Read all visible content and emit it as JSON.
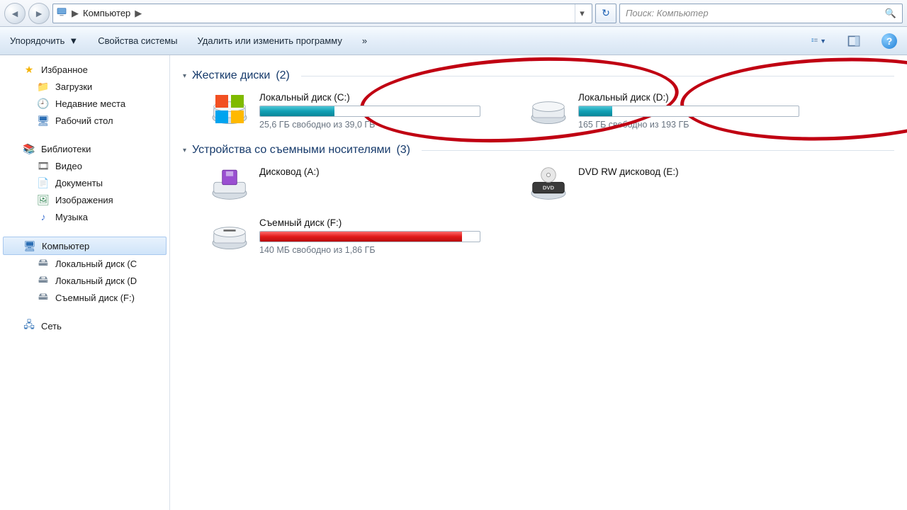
{
  "address": {
    "location": "Компьютер",
    "sep": "▶"
  },
  "search": {
    "placeholder": "Поиск: Компьютер"
  },
  "toolbar": {
    "organize": "Упорядочить",
    "sysprops": "Свойства системы",
    "uninstall": "Удалить или изменить программу",
    "more": "»"
  },
  "sidebar": {
    "favorites": "Избранное",
    "downloads": "Загрузки",
    "recent": "Недавние места",
    "desktop": "Рабочий стол",
    "libraries": "Библиотеки",
    "video": "Видео",
    "documents": "Документы",
    "pictures": "Изображения",
    "music": "Музыка",
    "computer": "Компьютер",
    "localC": "Локальный диск  (C",
    "localD": "Локальный диск (D",
    "remF": "Съемный диск (F:)",
    "network": "Сеть"
  },
  "sections": {
    "hdd": {
      "title": "Жесткие диски",
      "count": "(2)"
    },
    "removable": {
      "title": "Устройства со съемными носителями",
      "count": "(3)"
    }
  },
  "drives": {
    "c": {
      "name": "Локальный диск  (C:)",
      "sub": "25,6 ГБ свободно из 39,0 ГБ",
      "fill_pct": 34,
      "color": "teal"
    },
    "d": {
      "name": "Локальный диск (D:)",
      "sub": "165 ГБ свободно из 193 ГБ",
      "fill_pct": 15,
      "color": "teal"
    },
    "a": {
      "name": "Дисковод (A:)"
    },
    "e": {
      "name": "DVD RW дисковод (E:)"
    },
    "f": {
      "name": "Съемный диск (F:)",
      "sub": "140 МБ свободно из 1,86 ГБ",
      "fill_pct": 92,
      "color": "red"
    }
  }
}
